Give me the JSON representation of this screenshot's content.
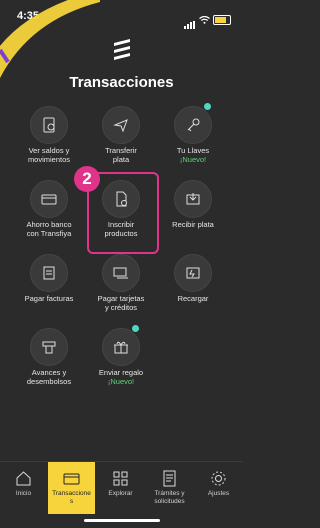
{
  "status": {
    "time": "4:35"
  },
  "title": "Transacciones",
  "annotation_badge": "2",
  "tiles": [
    {
      "line1": "Ver saldos y",
      "line2": "movimientos",
      "icon": "document-dollar-icon"
    },
    {
      "line1": "Transferir",
      "line2": "plata",
      "icon": "transfer-plane-icon"
    },
    {
      "line1": "Tu Llaves",
      "line2": "¡Nuevo!",
      "icon": "key-icon",
      "is_new": true
    },
    {
      "line1": "Ahorro banco",
      "line2": "con Transfiya",
      "icon": "bank-card-icon"
    },
    {
      "line1": "Inscribir",
      "line2": "productos",
      "icon": "add-document-icon"
    },
    {
      "line1": "Recibir plata",
      "line2": "",
      "icon": "receive-money-icon"
    },
    {
      "line1": "Pagar facturas",
      "line2": "",
      "icon": "invoice-icon"
    },
    {
      "line1": "Pagar tarjetas",
      "line2": "y créditos",
      "icon": "card-pay-icon"
    },
    {
      "line1": "Recargar",
      "line2": "",
      "icon": "recharge-icon"
    },
    {
      "line1": "Avances y",
      "line2": "desembolsos",
      "icon": "atm-icon"
    },
    {
      "line1": "Enviar regalo",
      "line2": "¡Nuevo!",
      "icon": "gift-icon",
      "is_new": true
    }
  ],
  "tabs": [
    {
      "label1": "Inicio",
      "label2": "",
      "icon": "home-icon"
    },
    {
      "label1": "Transaccione",
      "label2": "s",
      "icon": "wallet-icon",
      "active": true
    },
    {
      "label1": "Explorar",
      "label2": "",
      "icon": "grid-icon"
    },
    {
      "label1": "Trámites y",
      "label2": "solicitudes",
      "icon": "paperwork-icon"
    },
    {
      "label1": "Ajustes",
      "label2": "",
      "icon": "gear-icon"
    }
  ],
  "colors": {
    "background": "#2b2b2b",
    "accent": "#f7d43b",
    "highlight": "#e0338a",
    "new_badge": "#4dd8c3"
  }
}
